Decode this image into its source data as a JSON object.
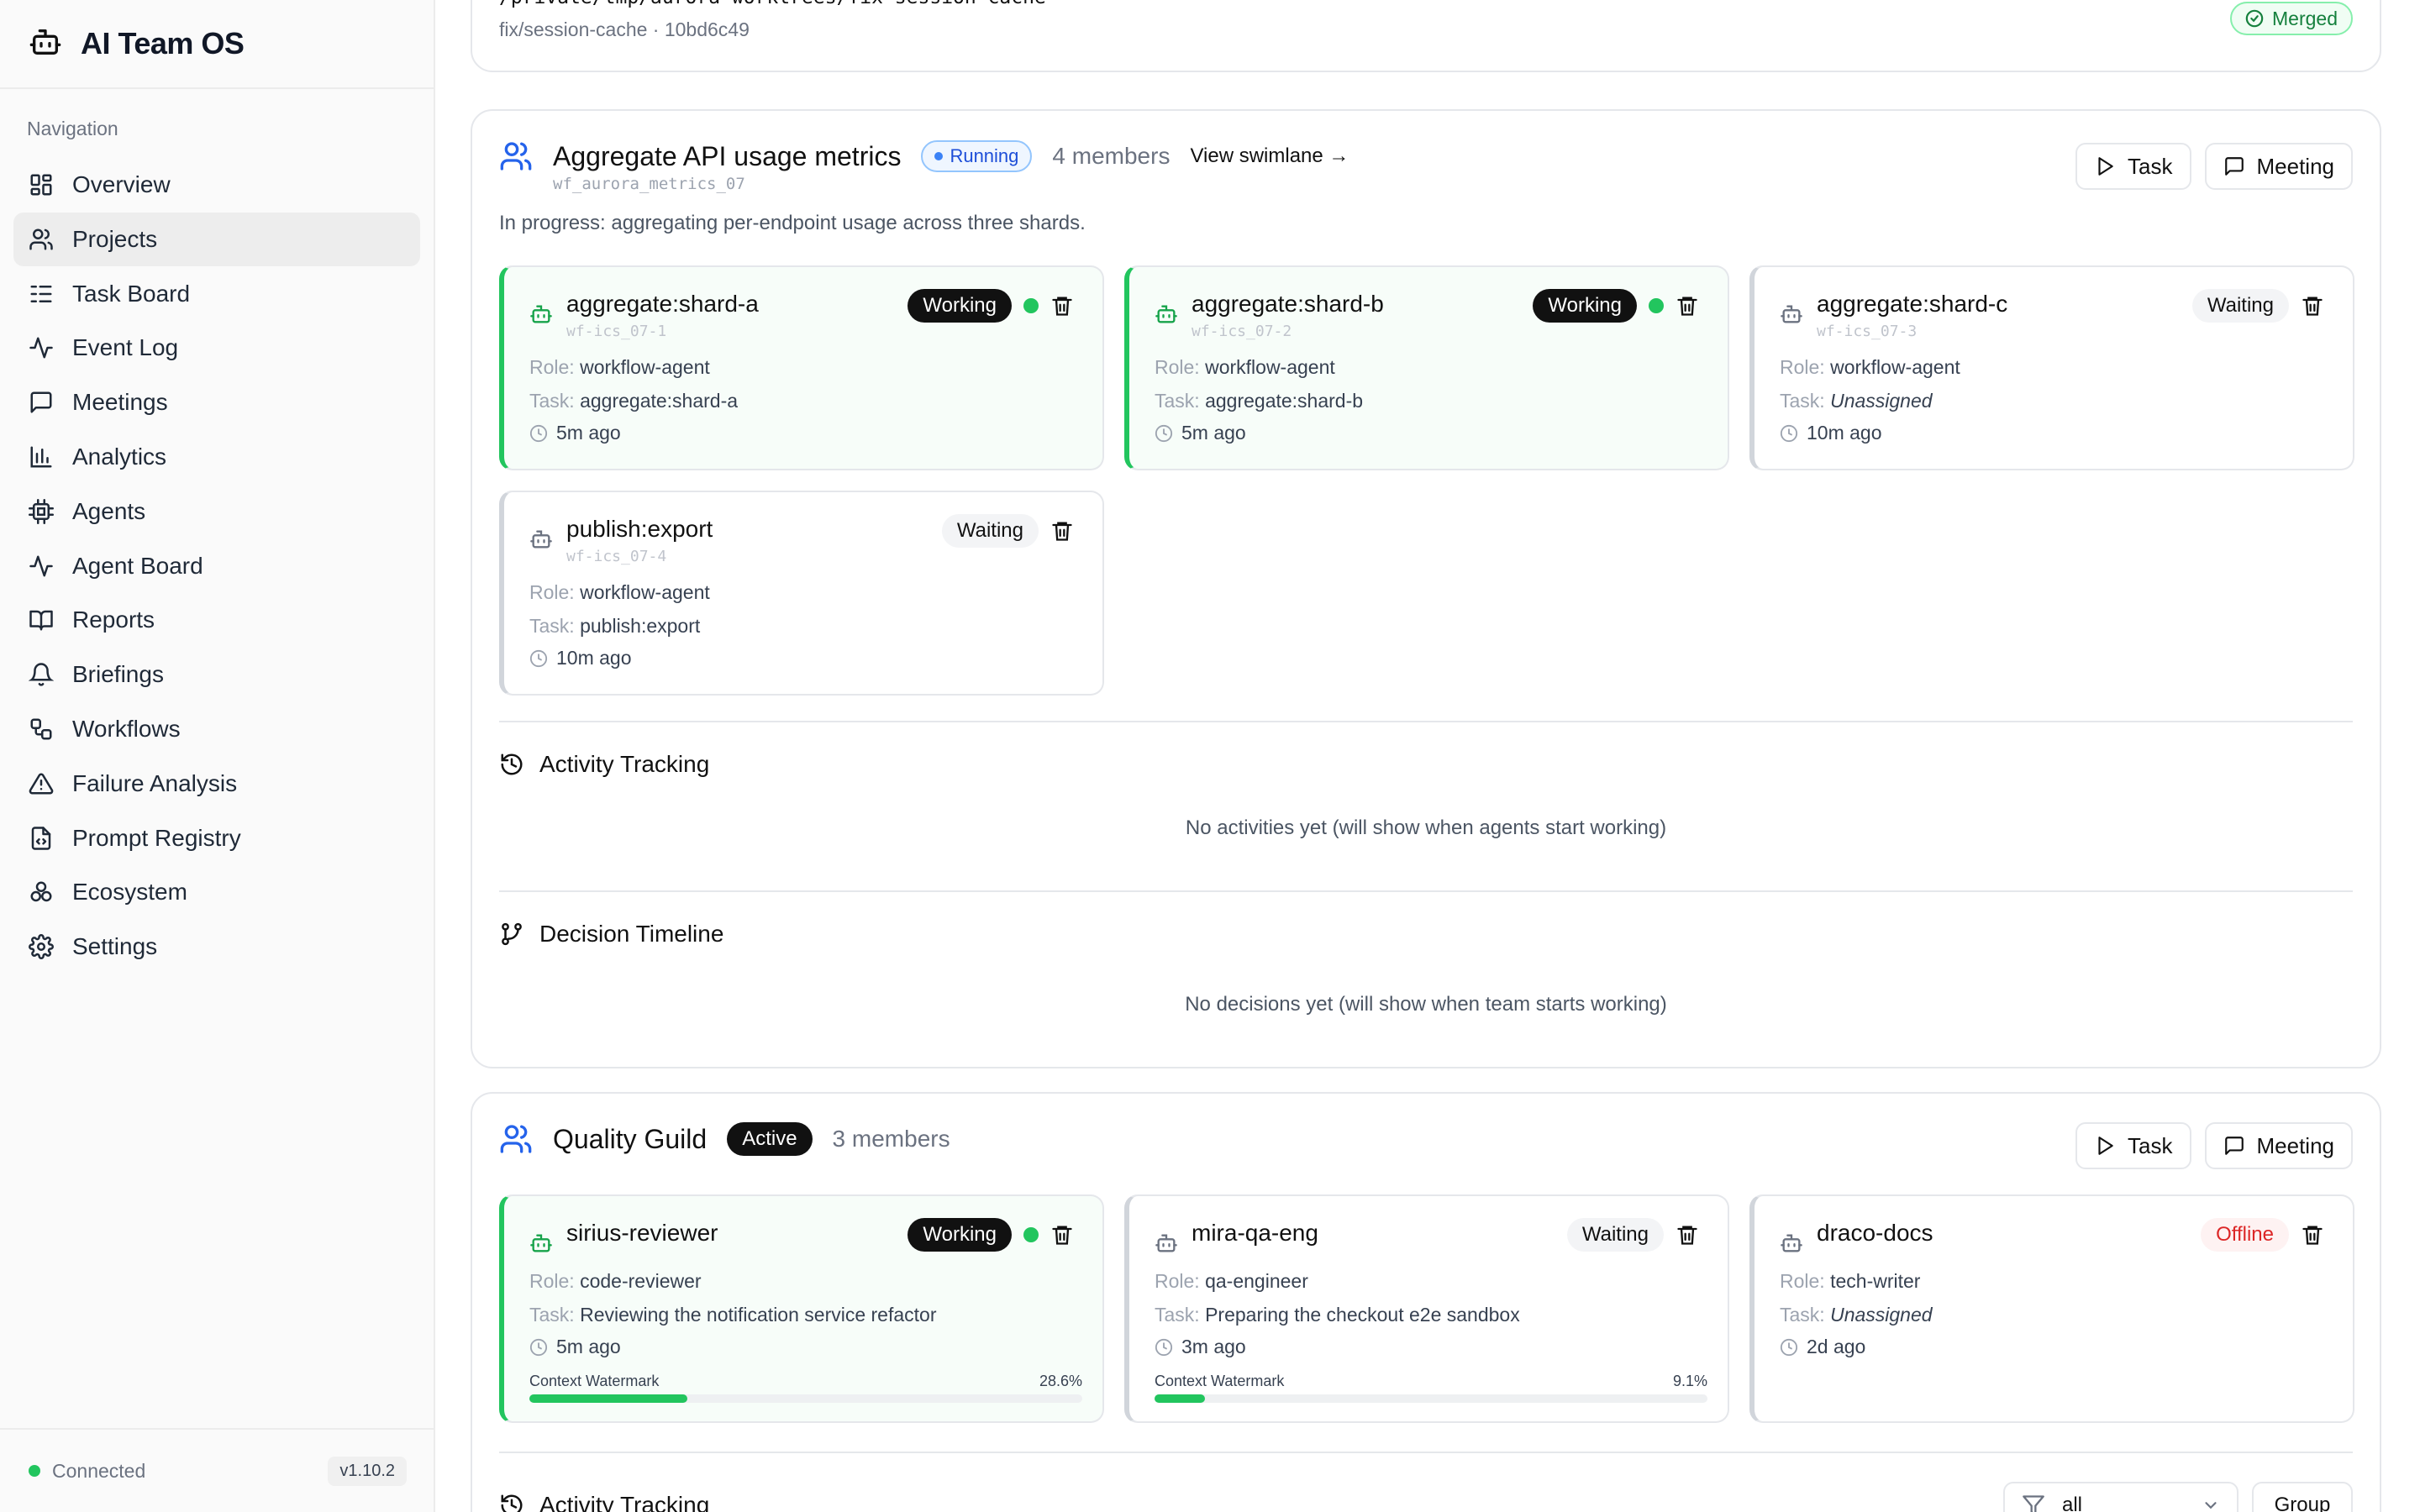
{
  "app": {
    "title": "AI Team OS"
  },
  "sidebar": {
    "heading": "Navigation",
    "items": [
      {
        "label": "Overview",
        "icon": "grid-icon"
      },
      {
        "label": "Projects",
        "icon": "users-icon",
        "active": true
      },
      {
        "label": "Task Board",
        "icon": "list-icon"
      },
      {
        "label": "Event Log",
        "icon": "activity-icon"
      },
      {
        "label": "Meetings",
        "icon": "message-square-icon"
      },
      {
        "label": "Analytics",
        "icon": "bar-chart-icon"
      },
      {
        "label": "Agents",
        "icon": "cpu-icon"
      },
      {
        "label": "Agent Board",
        "icon": "activity-icon"
      },
      {
        "label": "Reports",
        "icon": "book-open-icon"
      },
      {
        "label": "Briefings",
        "icon": "bell-icon"
      },
      {
        "label": "Workflows",
        "icon": "workflow-icon"
      },
      {
        "label": "Failure Analysis",
        "icon": "alert-triangle-icon"
      },
      {
        "label": "Prompt Registry",
        "icon": "file-code-icon"
      },
      {
        "label": "Ecosystem",
        "icon": "boxes-icon"
      },
      {
        "label": "Settings",
        "icon": "gear-icon"
      }
    ],
    "footer": {
      "status": "Connected",
      "version": "v1.10.2"
    }
  },
  "top_card": {
    "path": "/private/tmp/aurora-worktrees/fix-session-cache",
    "sub": "fix/session-cache · 10bd6c49",
    "badge": "Merged"
  },
  "team1": {
    "title": "Aggregate API usage metrics",
    "id": "wf_aurora_metrics_07",
    "status": "Running",
    "members": "4 members",
    "swimlane": "View swimlane →",
    "task_btn": "Task",
    "meeting_btn": "Meeting",
    "description": "In progress: aggregating per-endpoint usage across three shards.",
    "agents": [
      {
        "name": "aggregate:shard-a",
        "id": "wf-ics_07-1",
        "status": "Working",
        "role_label": "Role:",
        "role": "workflow-agent",
        "task_label": "Task:",
        "task": "aggregate:shard-a",
        "time": "5m ago"
      },
      {
        "name": "aggregate:shard-b",
        "id": "wf-ics_07-2",
        "status": "Working",
        "role_label": "Role:",
        "role": "workflow-agent",
        "task_label": "Task:",
        "task": "aggregate:shard-b",
        "time": "5m ago"
      },
      {
        "name": "aggregate:shard-c",
        "id": "wf-ics_07-3",
        "status": "Waiting",
        "role_label": "Role:",
        "role": "workflow-agent",
        "task_label": "Task:",
        "task": "Unassigned",
        "time": "10m ago"
      },
      {
        "name": "publish:export",
        "id": "wf-ics_07-4",
        "status": "Waiting",
        "role_label": "Role:",
        "role": "workflow-agent",
        "task_label": "Task:",
        "task": "publish:export",
        "time": "10m ago"
      }
    ],
    "activity_title": "Activity Tracking",
    "activity_empty": "No activities yet (will show when agents start working)",
    "decision_title": "Decision Timeline",
    "decision_empty": "No decisions yet (will show when team starts working)"
  },
  "team2": {
    "title": "Quality Guild",
    "status": "Active",
    "members": "3 members",
    "task_btn": "Task",
    "meeting_btn": "Meeting",
    "agents": [
      {
        "name": "sirius-reviewer",
        "status": "Working",
        "role_label": "Role:",
        "role": "code-reviewer",
        "task_label": "Task:",
        "task": "Reviewing the notification service refactor",
        "time": "5m ago",
        "watermark_label": "Context Watermark",
        "watermark_pct": "28.6%",
        "watermark_value": 0.286
      },
      {
        "name": "mira-qa-eng",
        "status": "Waiting",
        "role_label": "Role:",
        "role": "qa-engineer",
        "task_label": "Task:",
        "task": "Preparing the checkout e2e sandbox",
        "time": "3m ago",
        "watermark_label": "Context Watermark",
        "watermark_pct": "9.1%",
        "watermark_value": 0.091
      },
      {
        "name": "draco-docs",
        "status": "Offline",
        "role_label": "Role:",
        "role": "tech-writer",
        "task_label": "Task:",
        "task": "Unassigned",
        "time": "2d ago"
      }
    ],
    "activity_title": "Activity Tracking",
    "filter_value": "all",
    "group_btn": "Group"
  },
  "colors": {
    "accent_blue": "#2563eb",
    "green": "#22c55e",
    "red": "#dc2626"
  }
}
